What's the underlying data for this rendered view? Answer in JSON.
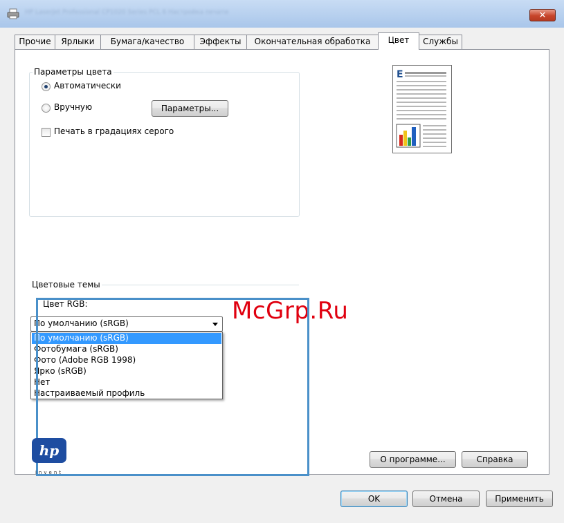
{
  "window": {
    "title": "HP LaserJet Professional CP1020 Series PCL 6 Настройка печати",
    "close_label": "✕"
  },
  "tabs": [
    {
      "label": "Прочие"
    },
    {
      "label": "Ярлыки"
    },
    {
      "label": "Бумага/качество"
    },
    {
      "label": "Эффекты"
    },
    {
      "label": "Окончательная обработка"
    },
    {
      "label": "Цвет",
      "active": true
    },
    {
      "label": "Службы"
    }
  ],
  "color_options": {
    "group_title": "Параметры цвета",
    "automatic_label": "Автоматически",
    "automatic_checked": true,
    "manual_label": "Вручную",
    "manual_checked": false,
    "params_button": "Параметры...",
    "grayscale_label": "Печать в градациях серого",
    "grayscale_checked": false
  },
  "color_themes": {
    "group_title": "Цветовые темы",
    "rgb_label": "Цвет RGB:",
    "selected": "По умолчанию (sRGB)",
    "options": [
      "По умолчанию (sRGB)",
      "Фотобумага (sRGB)",
      "Фото (Adobe RGB 1998)",
      "Ярко (sRGB)",
      "Нет",
      "Настраиваемый профиль"
    ]
  },
  "watermark": "McGrp.Ru",
  "logo": {
    "mark": "hp",
    "tagline": "invent"
  },
  "buttons": {
    "about": "О программе...",
    "help": "Справка",
    "ok": "OK",
    "cancel": "Отмена",
    "apply": "Применить"
  },
  "preview": {
    "letter": "E",
    "bar_colors": [
      "#d62c1f",
      "#f0c419",
      "#2f9e44",
      "#1f5fbf"
    ]
  },
  "colors": {
    "accent": "#4a90c9",
    "selection": "#3399ff",
    "watermark": "#e0000f"
  }
}
